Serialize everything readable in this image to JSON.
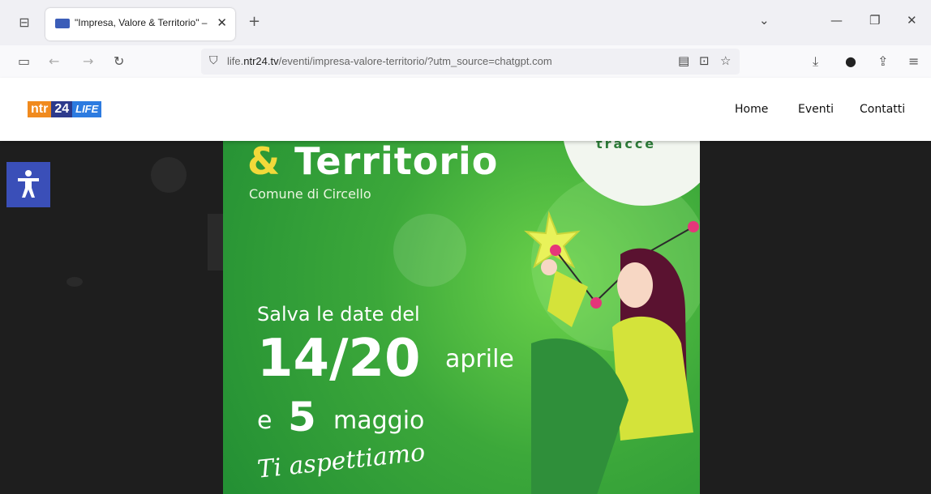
{
  "browser": {
    "tab_title": "\"Impresa, Valore & Territorio\" –",
    "url_prefix": "life.",
    "url_domain": "ntr24.tv",
    "url_path": "/eventi/impresa-valore-territorio/?utm_source=chatgpt.com"
  },
  "site": {
    "logo": {
      "part1": "ntr",
      "part2": "24",
      "part3": "LIFE"
    },
    "nav": [
      "Home",
      "Eventi",
      "Contatti"
    ]
  },
  "poster": {
    "title_amp": "&",
    "title_word": "Territorio",
    "subtitle": "Comune di Circello",
    "badge": "tracce",
    "save_line": "Salva le date del",
    "date_range": "14/20",
    "month1": "aprile",
    "conj": "e",
    "day2": "5",
    "month2": "maggio",
    "closing": "Ti aspettiamo"
  },
  "colors": {
    "accessibility": "#3a4fb8",
    "logo_orange": "#f08a1e",
    "logo_navy": "#2d3a8c",
    "poster_green": "#3ca83a"
  }
}
